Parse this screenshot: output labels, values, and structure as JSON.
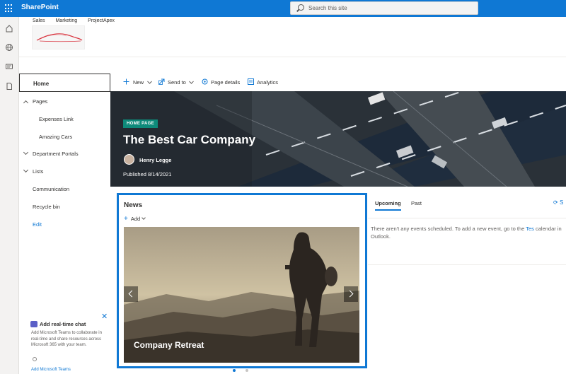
{
  "suite": {
    "app_name": "SharePoint",
    "search_placeholder": "Search this site"
  },
  "hub_nav": [
    "Sales",
    "Marketing",
    "ProjectApex"
  ],
  "rail_icons": [
    "home-icon",
    "globe-icon",
    "news-icon",
    "page-icon"
  ],
  "left_nav": {
    "home": "Home",
    "pages": "Pages",
    "expenses_link": "Expenses Link",
    "amazing_cars": "Amazing Cars",
    "department_portals": "Department Portals",
    "lists": "Lists",
    "communication": "Communication",
    "recycle_bin": "Recycle bin",
    "edit": "Edit"
  },
  "chat_promo": {
    "title": "Add real-time chat",
    "body": "Add Microsoft Teams to collaborate in real-time and share resources across Microsoft 365 with your team.",
    "link": "Add Microsoft Teams"
  },
  "command_bar": {
    "new": "New",
    "send_to": "Send to",
    "page_details": "Page details",
    "analytics": "Analytics"
  },
  "hero": {
    "badge": "HOME PAGE",
    "title": "The Best Car Company",
    "author": "Henry Legge",
    "published": "Published 8/14/2021"
  },
  "news": {
    "title": "News",
    "add": "Add",
    "caption": "Company Retreat"
  },
  "events": {
    "tab_upcoming": "Upcoming",
    "tab_past": "Past",
    "sync_label": "S",
    "message_before": "There aren't any events scheduled. To add a new event, go to the ",
    "message_link": "Tes",
    "message_after": "calendar in Outlook."
  },
  "colors": {
    "accent": "#0f78d4",
    "badge": "#0e8a7a"
  }
}
